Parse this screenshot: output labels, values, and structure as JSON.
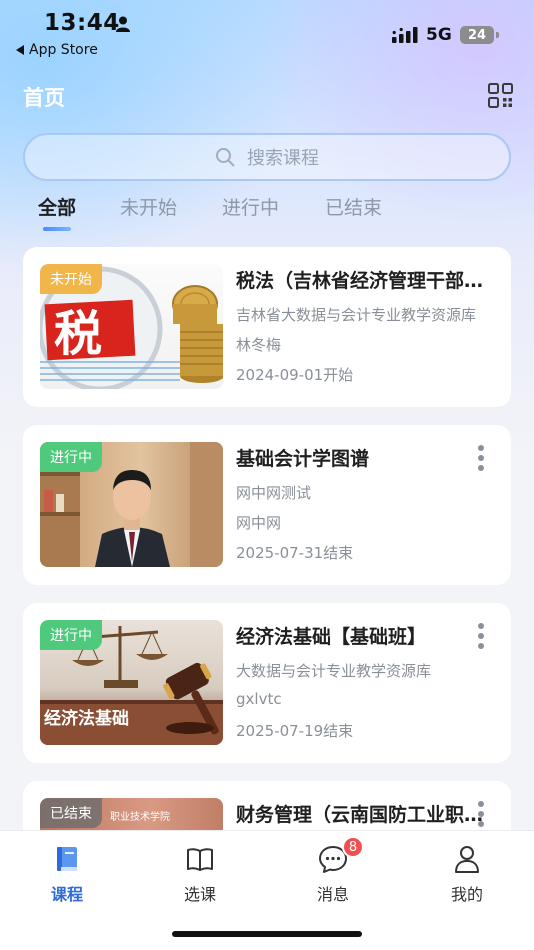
{
  "status_bar": {
    "time": "13:44",
    "back_app": "App Store",
    "network": "5G",
    "battery": "24"
  },
  "header": {
    "title": "首页",
    "qr_icon": "qr-code-icon"
  },
  "search": {
    "placeholder": "搜索课程",
    "icon": "search-icon"
  },
  "tabs": [
    {
      "label": "全部",
      "active": true
    },
    {
      "label": "未开始",
      "active": false
    },
    {
      "label": "进行中",
      "active": false
    },
    {
      "label": "已结束",
      "active": false
    }
  ],
  "courses": [
    {
      "badge": "未开始",
      "badge_color": "#f1b64a",
      "title": "税法（吉林省经济管理干部学院）",
      "subtitle": "吉林省大数据与会计专业教学资源库",
      "teacher": "林冬梅",
      "date": "2024-09-01开始",
      "has_more": false
    },
    {
      "badge": "进行中",
      "badge_color": "#4fc97c",
      "title": "基础会计学图谱",
      "subtitle": "网中网测试",
      "teacher": "网中网",
      "date": "2025-07-31结束",
      "has_more": true
    },
    {
      "badge": "进行中",
      "badge_color": "#4fc97c",
      "title": "经济法基础【基础班】",
      "subtitle": "大数据与会计专业教学资源库",
      "teacher": "gxlvtc",
      "date": "2025-07-19结束",
      "has_more": true,
      "thumb_text": "经济法基础"
    },
    {
      "badge": "已结束",
      "badge_color": "#707070",
      "title": "财务管理（云南国防工业职业技术学院）",
      "has_more": true,
      "thumb_text": "职业技术学院"
    }
  ],
  "tabbar": [
    {
      "label": "课程",
      "icon": "course-book-icon",
      "active": true
    },
    {
      "label": "选课",
      "icon": "open-book-icon",
      "active": false
    },
    {
      "label": "消息",
      "icon": "chat-bubble-icon",
      "active": false,
      "badge": "8"
    },
    {
      "label": "我的",
      "icon": "user-icon",
      "active": false
    }
  ],
  "colors": {
    "accent": "#2f6bdb",
    "badge_red": "#f05050"
  }
}
